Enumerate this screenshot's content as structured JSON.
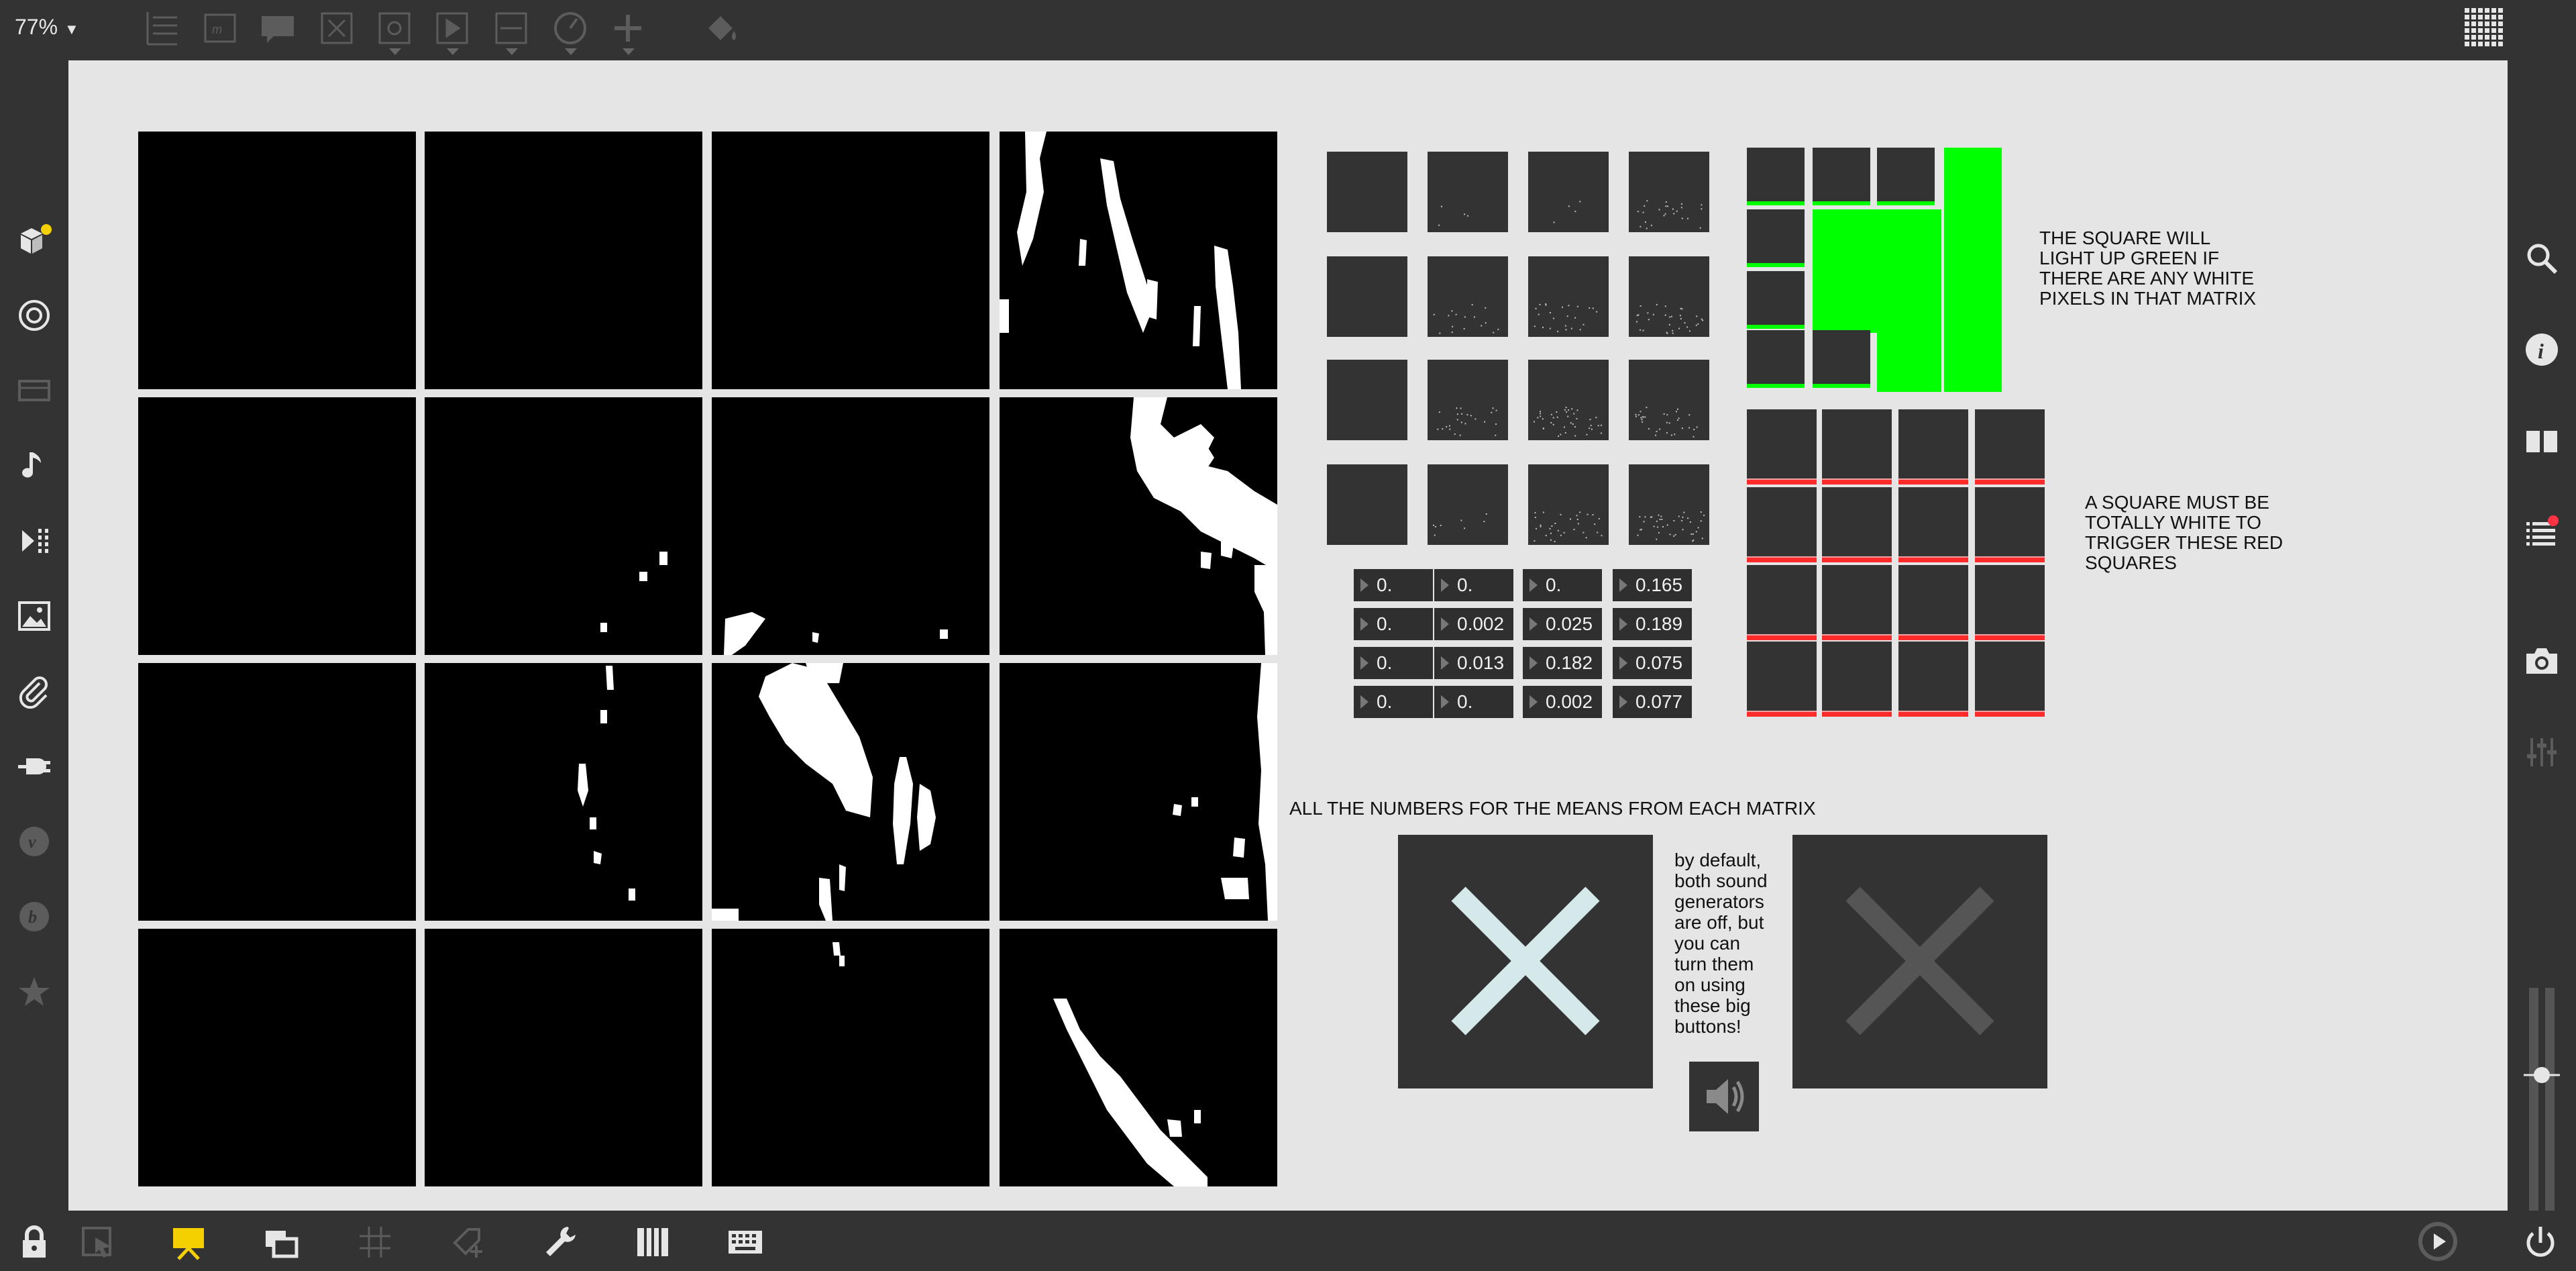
{
  "toolbar": {
    "zoom": "77%",
    "icons": [
      "patcher-list-icon",
      "message-box-icon",
      "comment-icon",
      "toggle-x-icon",
      "object-icon",
      "play-icon",
      "minus-box-icon",
      "dial-icon",
      "plus-icon",
      "paint-bucket-icon"
    ]
  },
  "left_sidebar": {
    "icons": [
      "objects-cube-icon",
      "target-icon",
      "display-icon",
      "music-note-icon",
      "media-step-icon",
      "image-icon",
      "paperclip-icon",
      "plug-icon",
      "vimeo-icon",
      "package-icon",
      "star-icon"
    ]
  },
  "right_sidebar": {
    "icons": [
      "search-icon",
      "info-icon",
      "book-icon",
      "list-icon",
      "camera-icon",
      "mixer-icon"
    ]
  },
  "bottom_toolbar": {
    "icons": [
      "lock-icon",
      "select-arrow-icon",
      "presentation-icon",
      "windows-icon",
      "grid-icon",
      "add-tag-icon",
      "wrench-icon",
      "piano-icon",
      "keyboard-icon",
      "transport-icon",
      "power-icon"
    ]
  },
  "patch": {
    "green_comment": "THE SQUARE WILL\nLIGHT UP GREEN IF\nTHERE ARE ANY WHITE\nPIXELS IN THAT MATRIX",
    "red_comment": "A SQUARE MUST BE\nTOTALLY WHITE TO\nTRIGGER THESE RED\nSQUARES",
    "means_comment": "ALL THE NUMBERS FOR THE MEANS FROM EACH MATRIX",
    "buttons_comment": "by default,\nboth sound\ngenerators\nare off, but\nyou can\nturn them\non using\nthese big\nbuttons!",
    "means": [
      [
        "0.",
        "0.",
        "0.",
        "0.165"
      ],
      [
        "0.",
        "0.002",
        "0.025",
        "0.189"
      ],
      [
        "0.",
        "0.013",
        "0.182",
        "0.075"
      ],
      [
        "0.",
        "0.",
        "0.002",
        "0.077"
      ]
    ],
    "green_state": [
      [
        false,
        false,
        false,
        true
      ],
      [
        false,
        true,
        true,
        true
      ],
      [
        false,
        true,
        true,
        true
      ],
      [
        false,
        false,
        true,
        true
      ]
    ]
  },
  "colors": {
    "canvas": "#e5e5e5",
    "chrome": "#333333",
    "green": "#00ff00",
    "red": "#ff2a2a",
    "yellow_accent": "#f5d000",
    "button_on_x": "#d5e8ea",
    "button_off_x": "#555555"
  }
}
